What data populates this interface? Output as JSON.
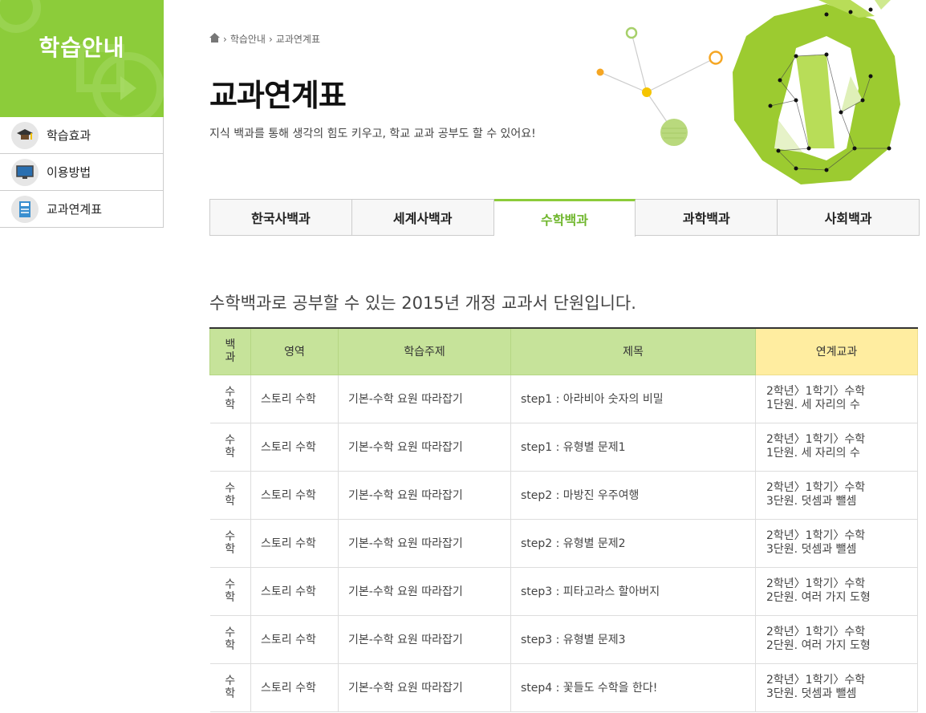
{
  "sidebar": {
    "title": "학습안내",
    "items": [
      {
        "label": "학습효과",
        "icon": "graduation-cap-icon"
      },
      {
        "label": "이용방법",
        "icon": "monitor-icon"
      },
      {
        "label": "교과연계표",
        "icon": "book-icon"
      }
    ]
  },
  "breadcrumb": {
    "items": [
      "학습안내",
      "교과연계표"
    ]
  },
  "page": {
    "title": "교과연계표",
    "subtitle": "지식 백과를 통해 생각의 힘도 키우고, 학교 교과 공부도 할 수 있어요!"
  },
  "tabs": [
    {
      "label": "한국사백과",
      "active": false
    },
    {
      "label": "세계사백과",
      "active": false
    },
    {
      "label": "수학백과",
      "active": true
    },
    {
      "label": "과학백과",
      "active": false
    },
    {
      "label": "사회백과",
      "active": false
    }
  ],
  "intro": "수학백과로 공부할 수 있는 2015년 개정 교과서 단원입니다.",
  "table": {
    "headers": [
      "백과",
      "영역",
      "학습주제",
      "제목",
      "연계교과"
    ],
    "rows": [
      {
        "cat": "수학",
        "area": "스토리 수학",
        "topic": "기본-수학 요원 따라잡기",
        "title": "step1 : 아라비아 숫자의 비밀",
        "link1": "2학년〉1학기〉수학",
        "link2": "1단원. 세 자리의 수"
      },
      {
        "cat": "수학",
        "area": "스토리 수학",
        "topic": "기본-수학 요원 따라잡기",
        "title": "step1 : 유형별 문제1",
        "link1": "2학년〉1학기〉수학",
        "link2": "1단원. 세 자리의 수"
      },
      {
        "cat": "수학",
        "area": "스토리 수학",
        "topic": "기본-수학 요원 따라잡기",
        "title": "step2 : 마방진 우주여행",
        "link1": "2학년〉1학기〉수학",
        "link2": "3단원. 덧셈과 뺄셈"
      },
      {
        "cat": "수학",
        "area": "스토리 수학",
        "topic": "기본-수학 요원 따라잡기",
        "title": "step2 : 유형별 문제2",
        "link1": "2학년〉1학기〉수학",
        "link2": "3단원. 덧셈과 뺄셈"
      },
      {
        "cat": "수학",
        "area": "스토리 수학",
        "topic": "기본-수학 요원 따라잡기",
        "title": "step3 : 피타고라스 할아버지",
        "link1": "2학년〉1학기〉수학",
        "link2": "2단원. 여러 가지 도형"
      },
      {
        "cat": "수학",
        "area": "스토리 수학",
        "topic": "기본-수학 요원 따라잡기",
        "title": "step3 : 유형별 문제3",
        "link1": "2학년〉1학기〉수학",
        "link2": "2단원. 여러 가지 도형"
      },
      {
        "cat": "수학",
        "area": "스토리 수학",
        "topic": "기본-수학 요원 따라잡기",
        "title": "step4 : 꽃들도 수학을 한다!",
        "link1": "2학년〉1학기〉수학",
        "link2": "3단원. 덧셈과 뺄셈"
      }
    ]
  },
  "colors": {
    "accent": "#8ccc3a",
    "header_green": "#c6e39a",
    "header_yellow": "#ffeda0"
  }
}
